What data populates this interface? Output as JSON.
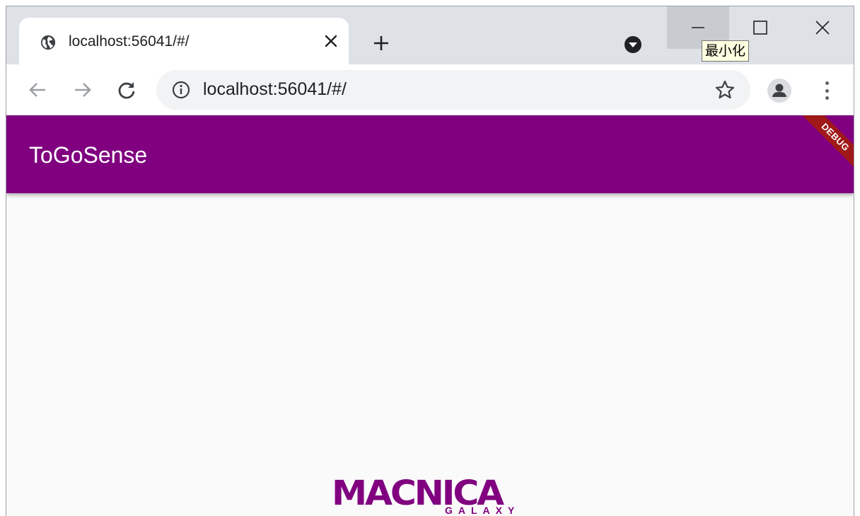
{
  "browser": {
    "tab": {
      "title": "localhost:56041/#/",
      "close_glyph": "✕"
    },
    "new_tab_glyph": "+",
    "window_controls": {
      "minimize_tooltip": "最小化"
    },
    "address_bar": {
      "url": "localhost:56041/#/"
    }
  },
  "app": {
    "title": "ToGoSense",
    "debug_banner": "DEBUG",
    "logo": {
      "main": "MACNICA",
      "sub": "GALAXY"
    }
  },
  "colors": {
    "appbar": "#800080",
    "debug_banner": "#a01818",
    "chrome_frame": "#dee1e6"
  },
  "icons": [
    "globe-icon",
    "close-icon",
    "plus-icon",
    "tab-search-icon",
    "minimize-icon",
    "maximize-icon",
    "window-close-icon",
    "back-arrow-icon",
    "forward-arrow-icon",
    "reload-icon",
    "info-icon",
    "star-icon",
    "profile-icon",
    "kebab-menu-icon"
  ]
}
